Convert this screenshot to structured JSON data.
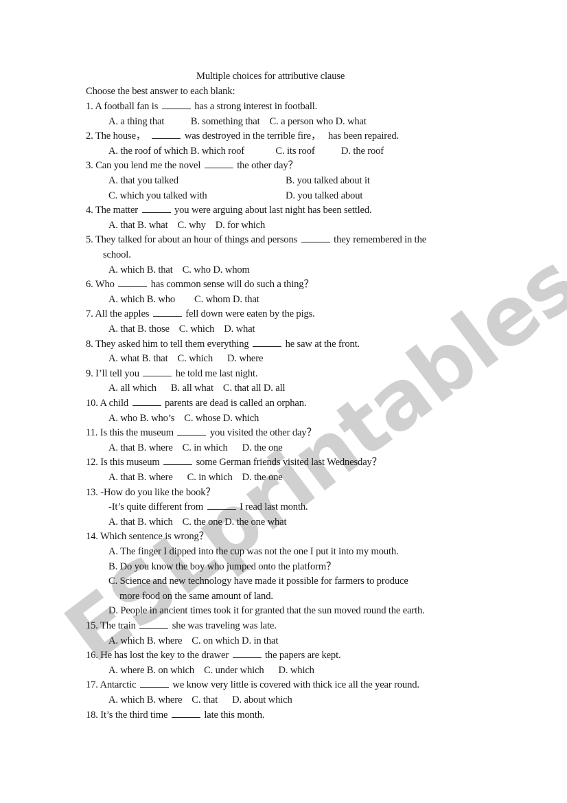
{
  "watermark": "ESLprintables.com",
  "title": "Multiple choices for attributive clause",
  "instructions": "Choose the best answer to each blank:",
  "lines": [
    {
      "kind": "q",
      "pre": "1. A football fan is ",
      "post": " has a strong interest in football."
    },
    {
      "kind": "opt",
      "text": "A. a thing that           B. something that    C. a person who D. what"
    },
    {
      "kind": "q",
      "pre": "2. The house，  ",
      "post": " was destroyed in the terrible fire，   has been repaired."
    },
    {
      "kind": "opt",
      "text": "A. the roof of which B. which roof             C. its roof           D. the roof"
    },
    {
      "kind": "q",
      "pre": "3. Can you lend me the novel ",
      "post": " the other day？"
    },
    {
      "kind": "opt2",
      "a": "A. that you talked",
      "b": "B. you talked about it"
    },
    {
      "kind": "opt2",
      "a": "C. which you talked with",
      "b": "D. you talked about"
    },
    {
      "kind": "q",
      "pre": "4. The matter ",
      "post": " you were arguing about last night has been settled."
    },
    {
      "kind": "opt",
      "text": "A. that B. what    C. why    D. for which"
    },
    {
      "kind": "q",
      "pre": "5. They talked for about an hour of things and persons ",
      "post": " they remembered in the"
    },
    {
      "kind": "cont",
      "text": "school."
    },
    {
      "kind": "opt",
      "text": "A. which B. that    C. who D. whom"
    },
    {
      "kind": "q",
      "pre": "6. Who ",
      "post": " has common sense will do such a thing？"
    },
    {
      "kind": "opt",
      "text": "A. which B. who        C. whom D. that"
    },
    {
      "kind": "q",
      "pre": "7. All the apples ",
      "post": " fell down were eaten by the pigs."
    },
    {
      "kind": "opt",
      "text": "A. that B. those    C. which    D. what"
    },
    {
      "kind": "q",
      "pre": "8. They asked him to tell them everything ",
      "post": " he saw at the front."
    },
    {
      "kind": "opt",
      "text": "A. what B. that    C. which      D. where"
    },
    {
      "kind": "q",
      "pre": "9. I’ll tell you ",
      "post": " he told me last night."
    },
    {
      "kind": "opt",
      "text": "A. all which      B. all what    C. that all D. all"
    },
    {
      "kind": "q",
      "pre": "10. A child ",
      "post": " parents are dead is called an orphan."
    },
    {
      "kind": "opt",
      "text": "A. who B. who’s    C. whose D. which"
    },
    {
      "kind": "q",
      "pre": "11. Is this the museum ",
      "post": " you visited the other day？"
    },
    {
      "kind": "opt",
      "text": "A. that B. where    C. in which      D. the one"
    },
    {
      "kind": "q",
      "pre": "12. Is this museum ",
      "post": " some German friends visited last Wednesday？"
    },
    {
      "kind": "opt",
      "text": "A. that B. where      C. in which    D. the one"
    },
    {
      "kind": "q",
      "pre": "13. -How do you like the book？",
      "post": null
    },
    {
      "kind": "optq",
      "pre": "-It’s quite different from ",
      "post": " I read last month."
    },
    {
      "kind": "opt",
      "text": "A. that B. which    C. the one D. the one what"
    },
    {
      "kind": "q",
      "pre": "14. Which sentence is wrong？",
      "post": null
    },
    {
      "kind": "opt",
      "text": "A. The finger I dipped into the cup was not the one I put it into my mouth."
    },
    {
      "kind": "opt",
      "text": "B. Do you know the boy who jumped onto the platform？"
    },
    {
      "kind": "opt",
      "text": "C. Science and new technology have made it possible for farmers to produce"
    },
    {
      "kind": "sub",
      "text": "more food on the same amount of land."
    },
    {
      "kind": "opt",
      "text": "D. People in ancient times took it for granted that the sun moved round the earth."
    },
    {
      "kind": "q",
      "pre": "15. The train ",
      "post": " she was traveling was late."
    },
    {
      "kind": "opt",
      "text": "A. which B. where    C. on which D. in that"
    },
    {
      "kind": "q",
      "pre": "16. He has lost the key to the drawer ",
      "post": " the papers are kept."
    },
    {
      "kind": "opt",
      "text": "A. where B. on which    C. under which      D. which"
    },
    {
      "kind": "q",
      "pre": "17. Antarctic ",
      "post": " we know very little is covered with thick ice all the year round."
    },
    {
      "kind": "opt",
      "text": "A. which B. where    C. that      D. about which"
    },
    {
      "kind": "q",
      "pre": "18. It’s the third time ",
      "post": " late this month."
    }
  ]
}
